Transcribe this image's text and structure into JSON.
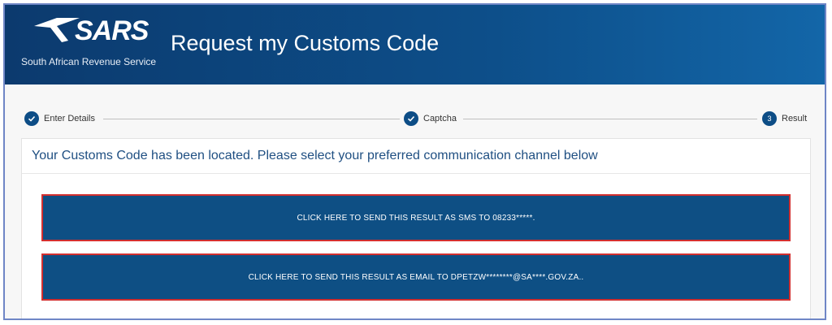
{
  "header": {
    "logo_text": "SARS",
    "logo_subtitle": "South African Revenue Service",
    "title": "Request my Customs Code",
    "colors": {
      "background": "#0d4f8a",
      "text": "#ffffff"
    }
  },
  "stepper": {
    "steps": [
      {
        "label": "Enter Details",
        "status": "complete",
        "icon": "check-icon"
      },
      {
        "label": "Captcha",
        "status": "complete",
        "icon": "check-icon"
      },
      {
        "label": "Result",
        "status": "current",
        "number": "3"
      }
    ],
    "accent_color": "#0d4d86"
  },
  "result": {
    "message": "Your Customs Code has been located. Please select your preferred communication channel below",
    "sms_button_label": "CLICK HERE TO SEND THIS RESULT AS SMS TO 08233*****.",
    "email_button_label": "CLICK HERE TO SEND THIS RESULT AS EMAIL TO DPETZW********@SA****.GOV.ZA..",
    "button_color": "#0e4f84",
    "highlight_border_color": "#d32f2f"
  }
}
